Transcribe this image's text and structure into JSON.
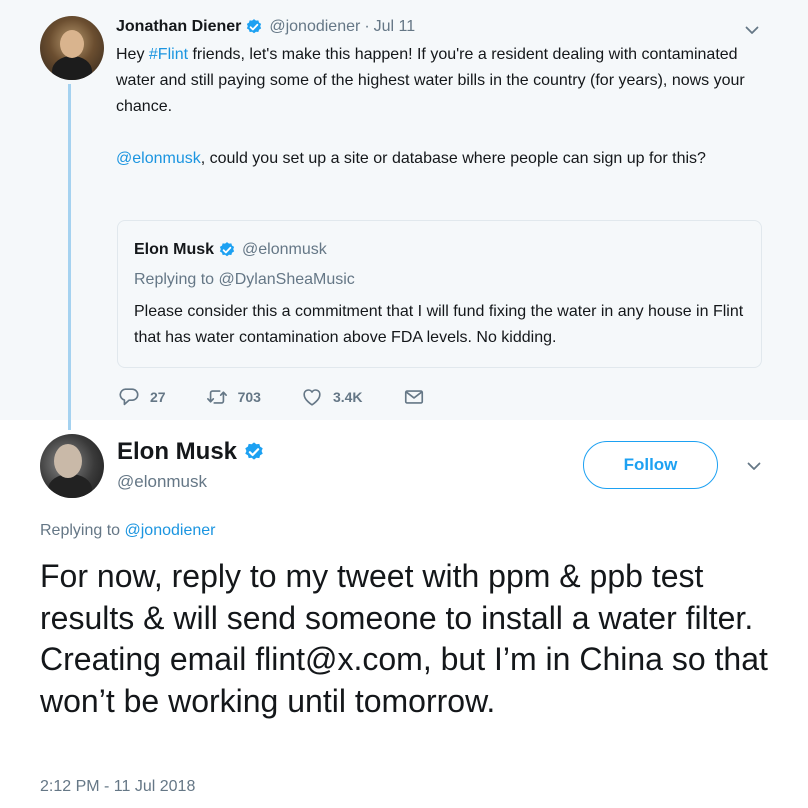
{
  "parent_tweet": {
    "author_name": "Jonathan Diener",
    "author_handle": "@jonodiener",
    "separator": "·",
    "date": "Jul 11",
    "text_part1": "Hey ",
    "hashtag": "#Flint",
    "text_part2": " friends, let's make this happen! If you're a resident dealing with contaminated water and still paying some of the highest water bills in the country (for years), nows your chance.",
    "mention": "@elonmusk",
    "text_part3": ", could you set up a site or database where people can sign up for this?",
    "quoted_tweet": {
      "author_name": "Elon Musk",
      "author_handle": "@elonmusk",
      "replying_prefix": "Replying to ",
      "replying_to": "@DylanSheaMusic",
      "text": "Please consider this a commitment that I will fund fixing the water in any house in Flint that has water contamination above FDA levels. No kidding."
    },
    "actions": {
      "replies": "27",
      "retweets": "703",
      "likes": "3.4K"
    }
  },
  "main_tweet": {
    "author_name": "Elon Musk",
    "author_handle": "@elonmusk",
    "follow_label": "Follow",
    "replying_prefix": "Replying to ",
    "replying_to": "@jonodiener",
    "text": "For now, reply to my tweet with ppm & ppb test results & will send someone to install a water filter. Creating email flint@x.com, but I’m in China so that won’t be working until tomorrow.",
    "timestamp": "2:12 PM - 11 Jul 2018"
  },
  "colors": {
    "link": "#1b95e0",
    "accent": "#1da1f2",
    "secondary_text": "#657786",
    "thread_line": "#a5d2f0",
    "parent_bg": "#f5f8fa"
  },
  "icons": [
    "verified-badge-icon",
    "chevron-down-icon",
    "reply-icon",
    "retweet-icon",
    "like-icon",
    "direct-message-icon"
  ]
}
